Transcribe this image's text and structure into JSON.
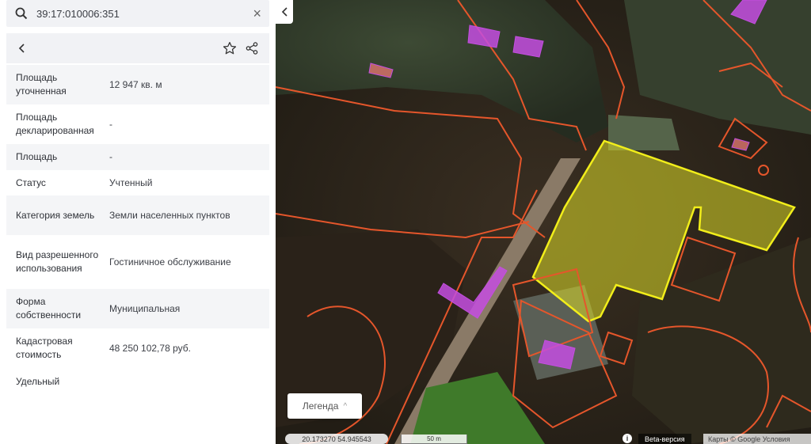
{
  "search": {
    "query": "39:17:010006:351"
  },
  "icons": {
    "search": "search-icon",
    "close": "close-icon",
    "back": "chevron-left-icon",
    "favorite": "star-icon",
    "share": "share-icon",
    "collapse": "chevron-left-icon"
  },
  "properties": [
    {
      "label": "Площадь уточненная",
      "value": "12 947 кв. м"
    },
    {
      "label": "Площадь декларированная",
      "value": "-"
    },
    {
      "label": "Площадь",
      "value": "-"
    },
    {
      "label": "Статус",
      "value": "Учтенный"
    },
    {
      "label": "Категория земель",
      "value": "Земли населенных пунктов"
    },
    {
      "label": "Вид разрешенного использования",
      "value": "Гостиничное обслуживание"
    },
    {
      "label": "Форма собственности",
      "value": "Муниципальная"
    },
    {
      "label": "Кадастровая стоимость",
      "value": "48 250 102,78 руб."
    },
    {
      "label": "Удельный",
      "value": ""
    }
  ],
  "map": {
    "legend_label": "Легенда",
    "coordinates": "20.173270  54.945543",
    "scale": "50 m",
    "info": "i",
    "beta_label": "Beta-версия",
    "attribution": "Карты © Google  Условия"
  },
  "colors": {
    "selected_parcel": "#f2ee1a",
    "parcel_border": "#e5562b",
    "building": "#c44de0"
  }
}
